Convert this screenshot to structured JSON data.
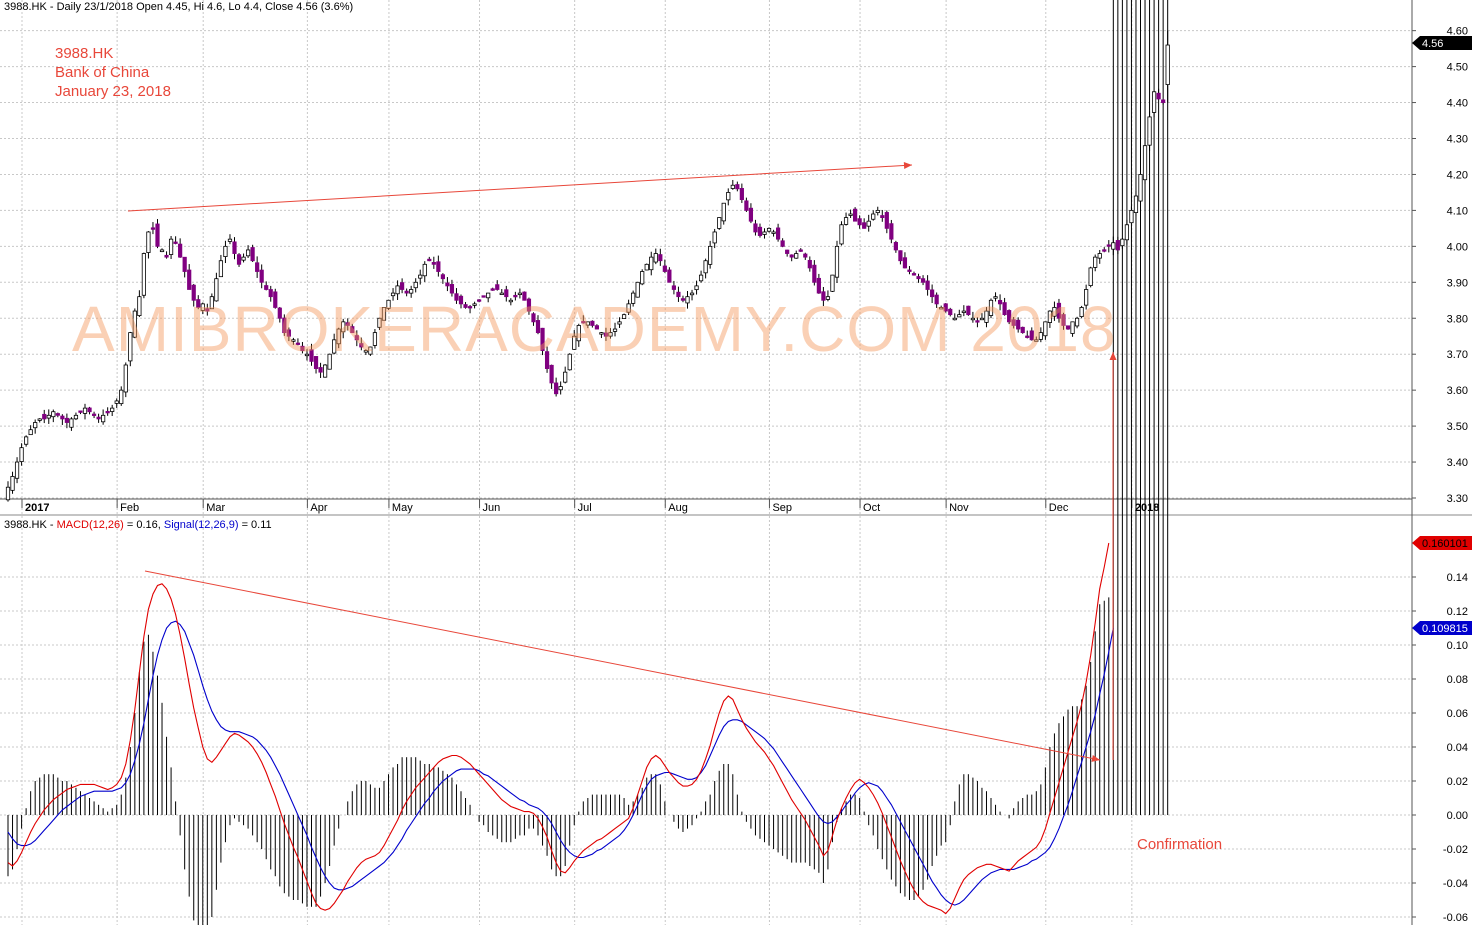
{
  "header": {
    "price_title": "3988.HK - Daily 23/1/2018 Open 4.45, Hi 4.6, Lo 4.4, Close 4.56 (3.6%)",
    "macd_prefix": "3988.HK - ",
    "macd_label": "MACD(12,26)",
    "macd_value": " = 0.16, ",
    "signal_label": "Signal(12,26,9)",
    "signal_value": " = 0.11"
  },
  "annotations": {
    "ticker": "3988.HK",
    "company": "Bank of China",
    "date": "January 23, 2018",
    "watermark": "AMIBROKERACADEMY.COM  2018",
    "confirmation": "Confirmation"
  },
  "colors": {
    "up_candle": "#ffffff",
    "down_candle": "#800080",
    "macd": "#e00000",
    "signal": "#0000cc",
    "histogram": "#000000",
    "annotation": "#e8473a",
    "grid": "#c8c8c8"
  },
  "chart_data": [
    {
      "type": "candlestick",
      "title": "3988.HK - Daily 23/1/2018 Open 4.45, Hi 4.6, Lo 4.4, Close 4.56 (3.6%)",
      "xlabel": "",
      "ylabel": "",
      "ylim": [
        3.29,
        4.62
      ],
      "y_ticks": [
        "3.30",
        "3.40",
        "3.50",
        "3.60",
        "3.70",
        "3.80",
        "3.90",
        "4.00",
        "4.10",
        "4.20",
        "4.30",
        "4.40",
        "4.50",
        "4.60"
      ],
      "month_labels": [
        "2017",
        "Feb",
        "Mar",
        "Apr",
        "May",
        "Jun",
        "Jul",
        "Aug",
        "Sep",
        "Oct",
        "Nov",
        "Dec",
        "2018"
      ],
      "month_starts": [
        0,
        21,
        40,
        63,
        81,
        101,
        122,
        142,
        165,
        185,
        204,
        226,
        245
      ],
      "last_price": "4.56",
      "closes": [
        3.33,
        3.36,
        3.4,
        3.44,
        3.47,
        3.49,
        3.51,
        3.52,
        3.52,
        3.53,
        3.54,
        3.53,
        3.52,
        3.51,
        3.52,
        3.53,
        3.54,
        3.55,
        3.54,
        3.53,
        3.52,
        3.53,
        3.54,
        3.55,
        3.57,
        3.6,
        3.67,
        3.76,
        3.82,
        3.86,
        3.98,
        4.04,
        4.05,
        4.0,
        3.99,
        3.97,
        4.02,
        4.01,
        3.97,
        3.93,
        3.88,
        3.85,
        3.83,
        3.84,
        3.82,
        3.86,
        3.91,
        3.96,
        4.0,
        4.02,
        3.98,
        3.95,
        3.97,
        3.99,
        3.96,
        3.93,
        3.9,
        3.88,
        3.86,
        3.83,
        3.8,
        3.76,
        3.75,
        3.74,
        3.73,
        3.71,
        3.7,
        3.68,
        3.66,
        3.65,
        3.67,
        3.7,
        3.74,
        3.77,
        3.79,
        3.78,
        3.76,
        3.74,
        3.72,
        3.71,
        3.72,
        3.76,
        3.8,
        3.83,
        3.85,
        3.87,
        3.89,
        3.88,
        3.87,
        3.88,
        3.9,
        3.92,
        3.95,
        3.96,
        3.95,
        3.93,
        3.91,
        3.89,
        3.87,
        3.85,
        3.84,
        3.83,
        3.83,
        3.84,
        3.85,
        3.86,
        3.87,
        3.88,
        3.88,
        3.87,
        3.86,
        3.85,
        3.86,
        3.87,
        3.85,
        3.82,
        3.79,
        3.76,
        3.71,
        3.66,
        3.62,
        3.59,
        3.61,
        3.65,
        3.7,
        3.75,
        3.78,
        3.79,
        3.79,
        3.78,
        3.77,
        3.76,
        3.75,
        3.76,
        3.77,
        3.79,
        3.81,
        3.84,
        3.87,
        3.9,
        3.93,
        3.95,
        3.97,
        3.98,
        3.96,
        3.93,
        3.9,
        3.88,
        3.86,
        3.85,
        3.86,
        3.87,
        3.89,
        3.92,
        3.96,
        4.0,
        4.04,
        4.08,
        4.12,
        4.15,
        4.17,
        4.16,
        4.13,
        4.1,
        4.07,
        4.04,
        4.03,
        4.04,
        4.05,
        4.04,
        4.02,
        4.0,
        3.98,
        3.97,
        3.98,
        3.99,
        3.97,
        3.94,
        3.9,
        3.87,
        3.85,
        3.86,
        3.92,
        4.0,
        4.06,
        4.08,
        4.09,
        4.07,
        4.06,
        4.05,
        4.07,
        4.09,
        4.1,
        4.08,
        4.05,
        4.02,
        3.99,
        3.96,
        3.94,
        3.93,
        3.92,
        3.91,
        3.9,
        3.88,
        3.86,
        3.84,
        3.83,
        3.82,
        3.81,
        3.8,
        3.81,
        3.82,
        3.81,
        3.8,
        3.79,
        3.8,
        3.82,
        3.85,
        3.86,
        3.84,
        3.81,
        3.79,
        3.78,
        3.77,
        3.76,
        3.75,
        3.74,
        3.74,
        3.76,
        3.79,
        3.82,
        3.83,
        3.8,
        3.78,
        3.77,
        3.79,
        3.8,
        3.83,
        3.88,
        3.94,
        3.97,
        3.98,
        3.99,
        4.0,
        4.01,
        3.99,
        4.02,
        4.06,
        4.1,
        4.14,
        4.2,
        4.28,
        4.36,
        4.43,
        4.41,
        4.4,
        4.56
      ]
    },
    {
      "type": "line",
      "title": "3988.HK - MACD(12,26) = 0.16, Signal(12,26,9) = 0.11",
      "xlabel": "",
      "ylabel": "",
      "ylim": [
        -0.06,
        0.165
      ],
      "y_ticks": [
        "-0.06",
        "-0.04",
        "-0.02",
        "0.00",
        "0.02",
        "0.04",
        "0.06",
        "0.08",
        "0.10",
        "0.12",
        "0.14"
      ],
      "macd_last": "0.160101",
      "signal_last": "0.109815",
      "series": [
        {
          "name": "MACD(12,26)",
          "values": [
            -0.028,
            -0.03,
            -0.027,
            -0.022,
            -0.016,
            -0.01,
            -0.005,
            -0.001,
            0.003,
            0.006,
            0.009,
            0.011,
            0.013,
            0.015,
            0.016,
            0.017,
            0.018,
            0.018,
            0.018,
            0.018,
            0.017,
            0.016,
            0.015,
            0.016,
            0.018,
            0.022,
            0.03,
            0.044,
            0.062,
            0.084,
            0.105,
            0.121,
            0.13,
            0.135,
            0.136,
            0.133,
            0.127,
            0.118,
            0.106,
            0.092,
            0.077,
            0.063,
            0.051,
            0.04,
            0.033,
            0.031,
            0.034,
            0.038,
            0.042,
            0.046,
            0.048,
            0.047,
            0.045,
            0.043,
            0.04,
            0.036,
            0.031,
            0.025,
            0.018,
            0.011,
            0.003,
            -0.005,
            -0.012,
            -0.019,
            -0.025,
            -0.032,
            -0.039,
            -0.046,
            -0.052,
            -0.055,
            -0.056,
            -0.055,
            -0.052,
            -0.048,
            -0.044,
            -0.039,
            -0.035,
            -0.031,
            -0.028,
            -0.026,
            -0.025,
            -0.024,
            -0.022,
            -0.018,
            -0.013,
            -0.008,
            -0.003,
            0.003,
            0.008,
            0.012,
            0.016,
            0.019,
            0.022,
            0.025,
            0.028,
            0.031,
            0.033,
            0.034,
            0.035,
            0.035,
            0.034,
            0.032,
            0.03,
            0.027,
            0.024,
            0.021,
            0.018,
            0.015,
            0.012,
            0.009,
            0.007,
            0.005,
            0.004,
            0.003,
            0.002,
            0.002,
            0.001,
            -0.002,
            -0.007,
            -0.013,
            -0.021,
            -0.028,
            -0.033,
            -0.034,
            -0.031,
            -0.027,
            -0.024,
            -0.021,
            -0.019,
            -0.017,
            -0.015,
            -0.014,
            -0.012,
            -0.01,
            -0.008,
            -0.006,
            -0.004,
            -0.002,
            0.004,
            0.012,
            0.02,
            0.028,
            0.033,
            0.035,
            0.033,
            0.029,
            0.025,
            0.022,
            0.019,
            0.017,
            0.017,
            0.018,
            0.021,
            0.026,
            0.033,
            0.041,
            0.051,
            0.06,
            0.067,
            0.07,
            0.068,
            0.062,
            0.056,
            0.051,
            0.047,
            0.043,
            0.04,
            0.037,
            0.033,
            0.029,
            0.024,
            0.019,
            0.014,
            0.009,
            0.005,
            0.001,
            -0.003,
            -0.008,
            -0.013,
            -0.018,
            -0.024,
            -0.021,
            -0.012,
            -0.003,
            0.004,
            0.01,
            0.015,
            0.019,
            0.021,
            0.019,
            0.016,
            0.012,
            0.007,
            0.001,
            -0.006,
            -0.013,
            -0.02,
            -0.027,
            -0.033,
            -0.039,
            -0.044,
            -0.048,
            -0.051,
            -0.053,
            -0.054,
            -0.055,
            -0.056,
            -0.058,
            -0.055,
            -0.049,
            -0.043,
            -0.038,
            -0.035,
            -0.033,
            -0.031,
            -0.03,
            -0.029,
            -0.029,
            -0.03,
            -0.031,
            -0.032,
            -0.033,
            -0.03,
            -0.027,
            -0.025,
            -0.023,
            -0.021,
            -0.019,
            -0.015,
            -0.008,
            0.001,
            0.01,
            0.019,
            0.028,
            0.037,
            0.046,
            0.055,
            0.065,
            0.078,
            0.094,
            0.113,
            0.133,
            0.146,
            0.16
          ]
        },
        {
          "name": "Signal(12,26,9)",
          "values": [
            -0.01,
            -0.014,
            -0.017,
            -0.018,
            -0.018,
            -0.017,
            -0.015,
            -0.012,
            -0.009,
            -0.006,
            -0.003,
            0.0,
            0.003,
            0.005,
            0.007,
            0.009,
            0.011,
            0.012,
            0.013,
            0.014,
            0.014,
            0.014,
            0.014,
            0.014,
            0.015,
            0.016,
            0.019,
            0.024,
            0.032,
            0.042,
            0.054,
            0.068,
            0.082,
            0.094,
            0.103,
            0.11,
            0.113,
            0.114,
            0.112,
            0.108,
            0.101,
            0.094,
            0.085,
            0.076,
            0.068,
            0.061,
            0.056,
            0.052,
            0.05,
            0.049,
            0.049,
            0.049,
            0.048,
            0.047,
            0.046,
            0.044,
            0.041,
            0.038,
            0.034,
            0.029,
            0.024,
            0.018,
            0.012,
            0.006,
            0.0,
            -0.006,
            -0.012,
            -0.019,
            -0.025,
            -0.031,
            -0.036,
            -0.04,
            -0.043,
            -0.044,
            -0.044,
            -0.043,
            -0.042,
            -0.04,
            -0.038,
            -0.036,
            -0.034,
            -0.032,
            -0.03,
            -0.028,
            -0.025,
            -0.022,
            -0.018,
            -0.014,
            -0.009,
            -0.005,
            -0.001,
            0.003,
            0.007,
            0.01,
            0.014,
            0.017,
            0.02,
            0.022,
            0.024,
            0.026,
            0.027,
            0.027,
            0.027,
            0.027,
            0.026,
            0.024,
            0.023,
            0.021,
            0.019,
            0.017,
            0.015,
            0.013,
            0.011,
            0.009,
            0.008,
            0.006,
            0.005,
            0.004,
            0.002,
            -0.001,
            -0.005,
            -0.01,
            -0.015,
            -0.019,
            -0.022,
            -0.024,
            -0.025,
            -0.025,
            -0.024,
            -0.023,
            -0.021,
            -0.02,
            -0.018,
            -0.016,
            -0.014,
            -0.012,
            -0.009,
            -0.005,
            0.0,
            0.006,
            0.012,
            0.017,
            0.021,
            0.023,
            0.024,
            0.025,
            0.025,
            0.024,
            0.023,
            0.022,
            0.021,
            0.021,
            0.022,
            0.025,
            0.029,
            0.035,
            0.041,
            0.047,
            0.052,
            0.055,
            0.056,
            0.056,
            0.055,
            0.053,
            0.051,
            0.049,
            0.047,
            0.045,
            0.042,
            0.039,
            0.035,
            0.031,
            0.027,
            0.023,
            0.019,
            0.015,
            0.011,
            0.007,
            0.003,
            -0.001,
            -0.004,
            -0.005,
            -0.004,
            -0.001,
            0.002,
            0.006,
            0.009,
            0.013,
            0.016,
            0.018,
            0.019,
            0.018,
            0.017,
            0.014,
            0.01,
            0.006,
            0.001,
            -0.004,
            -0.009,
            -0.014,
            -0.019,
            -0.024,
            -0.029,
            -0.034,
            -0.039,
            -0.043,
            -0.047,
            -0.05,
            -0.052,
            -0.053,
            -0.052,
            -0.05,
            -0.047,
            -0.044,
            -0.041,
            -0.038,
            -0.036,
            -0.034,
            -0.033,
            -0.032,
            -0.032,
            -0.032,
            -0.032,
            -0.031,
            -0.03,
            -0.029,
            -0.027,
            -0.026,
            -0.024,
            -0.022,
            -0.019,
            -0.014,
            -0.008,
            -0.001,
            0.006,
            0.014,
            0.023,
            0.031,
            0.04,
            0.049,
            0.059,
            0.071,
            0.083,
            0.096,
            0.11
          ]
        }
      ]
    }
  ]
}
